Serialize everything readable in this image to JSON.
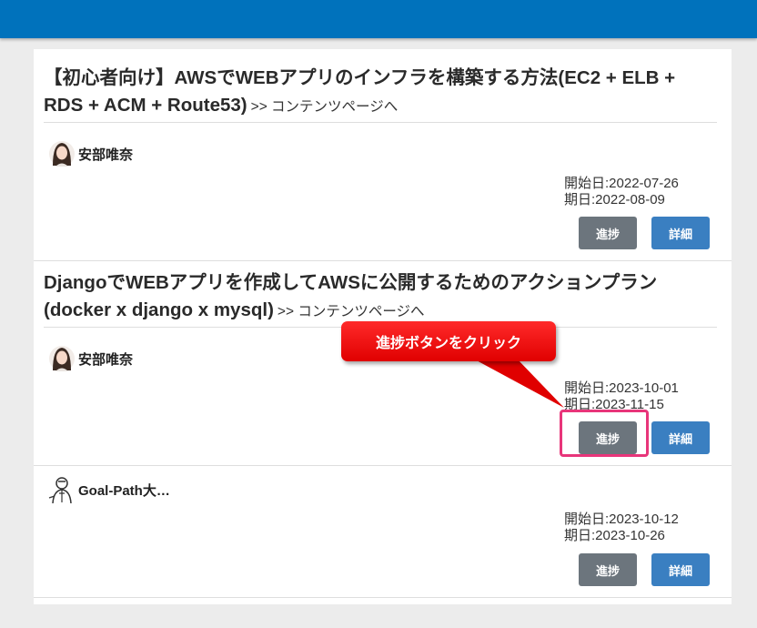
{
  "cards": [
    {
      "title": "【初心者向け】AWSでWEBアプリのインフラを構築する方法(EC2 + ELB + RDS + ACM + Route53)",
      "content_link": ">> コンテンツページへ",
      "author": "安部唯奈",
      "start_date": "開始日:2022-07-26",
      "due_date": "期日:2022-08-09",
      "progress_label": "進捗",
      "detail_label": "詳細"
    },
    {
      "title": "DjangoでWEBアプリを作成してAWSに公開するためのアクションプラン(docker x django x mysql)",
      "content_link": ">> コンテンツページへ",
      "author": "安部唯奈",
      "start_date": "開始日:2023-10-01",
      "due_date": "期日:2023-11-15",
      "progress_label": "進捗",
      "detail_label": "詳細"
    },
    {
      "author": "Goal-Path大…",
      "start_date": "開始日:2023-10-12",
      "due_date": "期日:2023-10-26",
      "progress_label": "進捗",
      "detail_label": "詳細"
    }
  ],
  "annotation": {
    "callout_text": "進捗ボタンをクリック",
    "color": "#ff0000",
    "highlight_color": "#e8357a"
  },
  "colors": {
    "topbar": "#0072bc",
    "progress_button": "#6c757d",
    "detail_button": "#3a7fc1"
  }
}
